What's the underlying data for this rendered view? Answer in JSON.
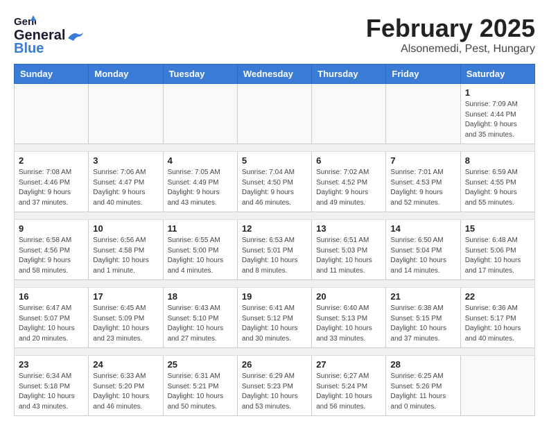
{
  "logo": {
    "line1": "General",
    "line2": "Blue"
  },
  "title": "February 2025",
  "location": "Alsonemedi, Pest, Hungary",
  "weekdays": [
    "Sunday",
    "Monday",
    "Tuesday",
    "Wednesday",
    "Thursday",
    "Friday",
    "Saturday"
  ],
  "weeks": [
    [
      {
        "day": "",
        "info": ""
      },
      {
        "day": "",
        "info": ""
      },
      {
        "day": "",
        "info": ""
      },
      {
        "day": "",
        "info": ""
      },
      {
        "day": "",
        "info": ""
      },
      {
        "day": "",
        "info": ""
      },
      {
        "day": "1",
        "info": "Sunrise: 7:09 AM\nSunset: 4:44 PM\nDaylight: 9 hours\nand 35 minutes."
      }
    ],
    [
      {
        "day": "2",
        "info": "Sunrise: 7:08 AM\nSunset: 4:46 PM\nDaylight: 9 hours\nand 37 minutes."
      },
      {
        "day": "3",
        "info": "Sunrise: 7:06 AM\nSunset: 4:47 PM\nDaylight: 9 hours\nand 40 minutes."
      },
      {
        "day": "4",
        "info": "Sunrise: 7:05 AM\nSunset: 4:49 PM\nDaylight: 9 hours\nand 43 minutes."
      },
      {
        "day": "5",
        "info": "Sunrise: 7:04 AM\nSunset: 4:50 PM\nDaylight: 9 hours\nand 46 minutes."
      },
      {
        "day": "6",
        "info": "Sunrise: 7:02 AM\nSunset: 4:52 PM\nDaylight: 9 hours\nand 49 minutes."
      },
      {
        "day": "7",
        "info": "Sunrise: 7:01 AM\nSunset: 4:53 PM\nDaylight: 9 hours\nand 52 minutes."
      },
      {
        "day": "8",
        "info": "Sunrise: 6:59 AM\nSunset: 4:55 PM\nDaylight: 9 hours\nand 55 minutes."
      }
    ],
    [
      {
        "day": "9",
        "info": "Sunrise: 6:58 AM\nSunset: 4:56 PM\nDaylight: 9 hours\nand 58 minutes."
      },
      {
        "day": "10",
        "info": "Sunrise: 6:56 AM\nSunset: 4:58 PM\nDaylight: 10 hours\nand 1 minute."
      },
      {
        "day": "11",
        "info": "Sunrise: 6:55 AM\nSunset: 5:00 PM\nDaylight: 10 hours\nand 4 minutes."
      },
      {
        "day": "12",
        "info": "Sunrise: 6:53 AM\nSunset: 5:01 PM\nDaylight: 10 hours\nand 8 minutes."
      },
      {
        "day": "13",
        "info": "Sunrise: 6:51 AM\nSunset: 5:03 PM\nDaylight: 10 hours\nand 11 minutes."
      },
      {
        "day": "14",
        "info": "Sunrise: 6:50 AM\nSunset: 5:04 PM\nDaylight: 10 hours\nand 14 minutes."
      },
      {
        "day": "15",
        "info": "Sunrise: 6:48 AM\nSunset: 5:06 PM\nDaylight: 10 hours\nand 17 minutes."
      }
    ],
    [
      {
        "day": "16",
        "info": "Sunrise: 6:47 AM\nSunset: 5:07 PM\nDaylight: 10 hours\nand 20 minutes."
      },
      {
        "day": "17",
        "info": "Sunrise: 6:45 AM\nSunset: 5:09 PM\nDaylight: 10 hours\nand 23 minutes."
      },
      {
        "day": "18",
        "info": "Sunrise: 6:43 AM\nSunset: 5:10 PM\nDaylight: 10 hours\nand 27 minutes."
      },
      {
        "day": "19",
        "info": "Sunrise: 6:41 AM\nSunset: 5:12 PM\nDaylight: 10 hours\nand 30 minutes."
      },
      {
        "day": "20",
        "info": "Sunrise: 6:40 AM\nSunset: 5:13 PM\nDaylight: 10 hours\nand 33 minutes."
      },
      {
        "day": "21",
        "info": "Sunrise: 6:38 AM\nSunset: 5:15 PM\nDaylight: 10 hours\nand 37 minutes."
      },
      {
        "day": "22",
        "info": "Sunrise: 6:36 AM\nSunset: 5:17 PM\nDaylight: 10 hours\nand 40 minutes."
      }
    ],
    [
      {
        "day": "23",
        "info": "Sunrise: 6:34 AM\nSunset: 5:18 PM\nDaylight: 10 hours\nand 43 minutes."
      },
      {
        "day": "24",
        "info": "Sunrise: 6:33 AM\nSunset: 5:20 PM\nDaylight: 10 hours\nand 46 minutes."
      },
      {
        "day": "25",
        "info": "Sunrise: 6:31 AM\nSunset: 5:21 PM\nDaylight: 10 hours\nand 50 minutes."
      },
      {
        "day": "26",
        "info": "Sunrise: 6:29 AM\nSunset: 5:23 PM\nDaylight: 10 hours\nand 53 minutes."
      },
      {
        "day": "27",
        "info": "Sunrise: 6:27 AM\nSunset: 5:24 PM\nDaylight: 10 hours\nand 56 minutes."
      },
      {
        "day": "28",
        "info": "Sunrise: 6:25 AM\nSunset: 5:26 PM\nDaylight: 11 hours\nand 0 minutes."
      },
      {
        "day": "",
        "info": ""
      }
    ]
  ]
}
